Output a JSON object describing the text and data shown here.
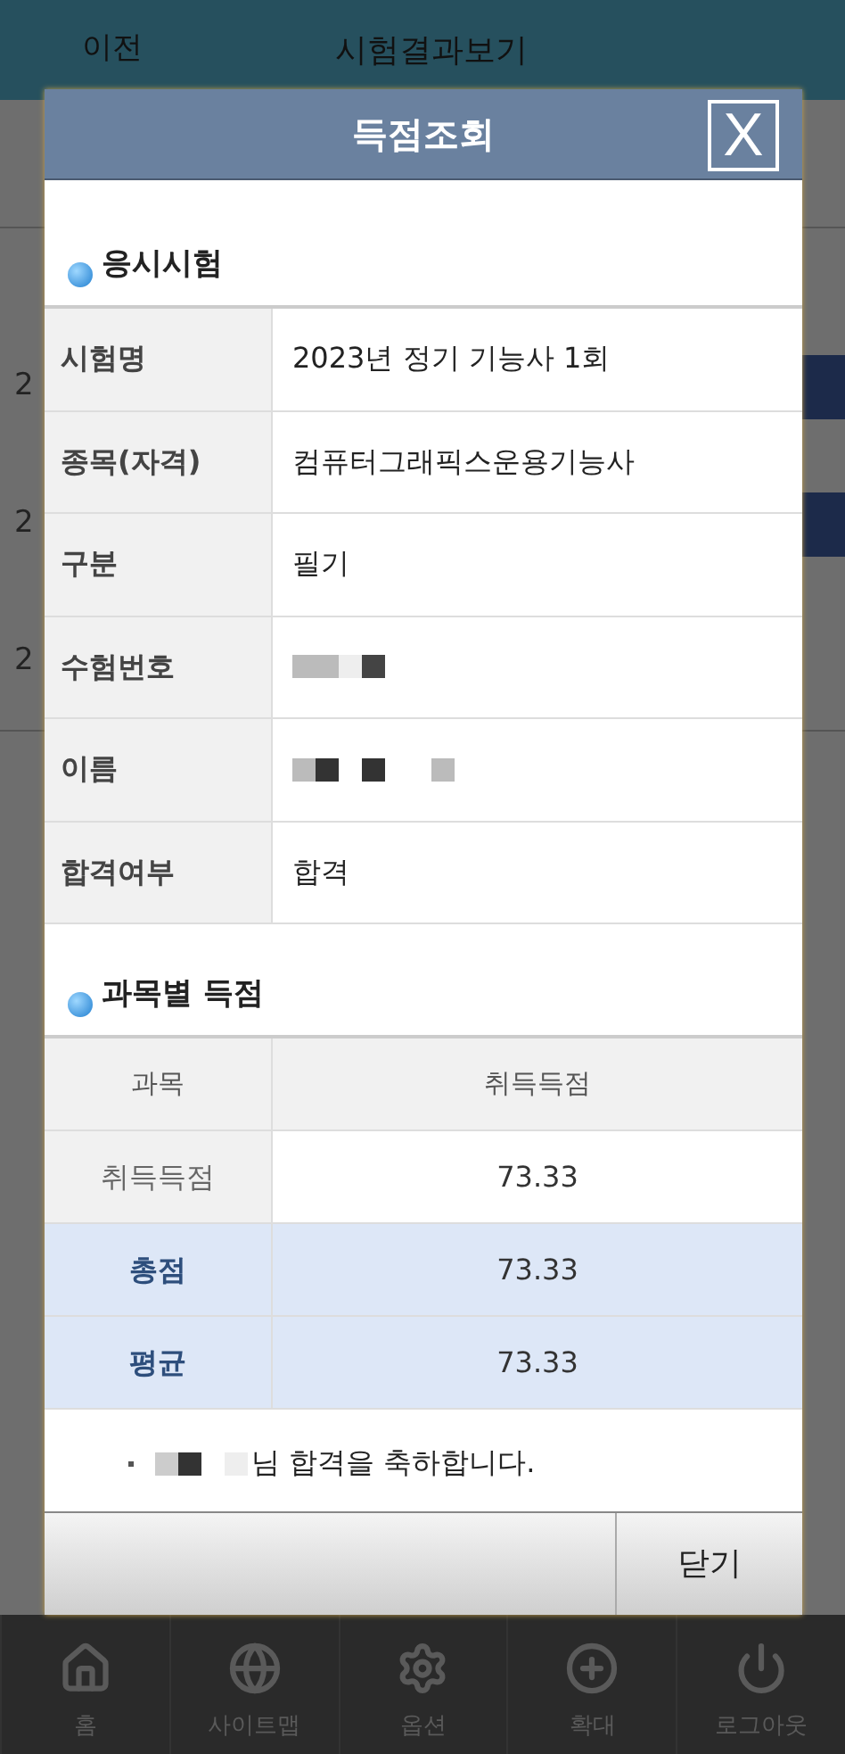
{
  "header": {
    "back": "이전",
    "title": "시험결과보기"
  },
  "background": {
    "rows": [
      {
        "text": "2",
        "kind": "with_button"
      },
      {
        "text": "2",
        "kind": "with_button"
      },
      {
        "text": "2",
        "kind": "plain"
      }
    ]
  },
  "dialog": {
    "title": "득점조회",
    "close": "X",
    "exam_section": {
      "title": "응시시험",
      "rows": [
        {
          "label": "시험명",
          "value": "2023년 정기 기능사 1회",
          "kind": "text"
        },
        {
          "label": "종목(자격)",
          "value": "컴퓨터그래픽스운용기능사",
          "kind": "text"
        },
        {
          "label": "구분",
          "value": "필기",
          "kind": "text"
        },
        {
          "label": "수험번호",
          "kind": "redacted"
        },
        {
          "label": "이름",
          "kind": "redacted"
        },
        {
          "label": "합격여부",
          "value": "합격",
          "kind": "text"
        }
      ]
    },
    "score_section": {
      "title": "과목별 득점",
      "columns": [
        "과목",
        "취득득점"
      ],
      "rows": [
        {
          "label": "취득득점",
          "value": "73.33",
          "kind": "subject"
        },
        {
          "label": "총점",
          "value": "73.33",
          "kind": "total"
        },
        {
          "label": "평균",
          "value": "73.33",
          "kind": "total"
        }
      ]
    },
    "message": "님 합격을 축하합니다.",
    "close_button": "닫기"
  },
  "bottom_nav": [
    {
      "label": "홈"
    },
    {
      "label": "사이트맵"
    },
    {
      "label": "옵션"
    },
    {
      "label": "확대"
    },
    {
      "label": "로그아웃"
    }
  ]
}
